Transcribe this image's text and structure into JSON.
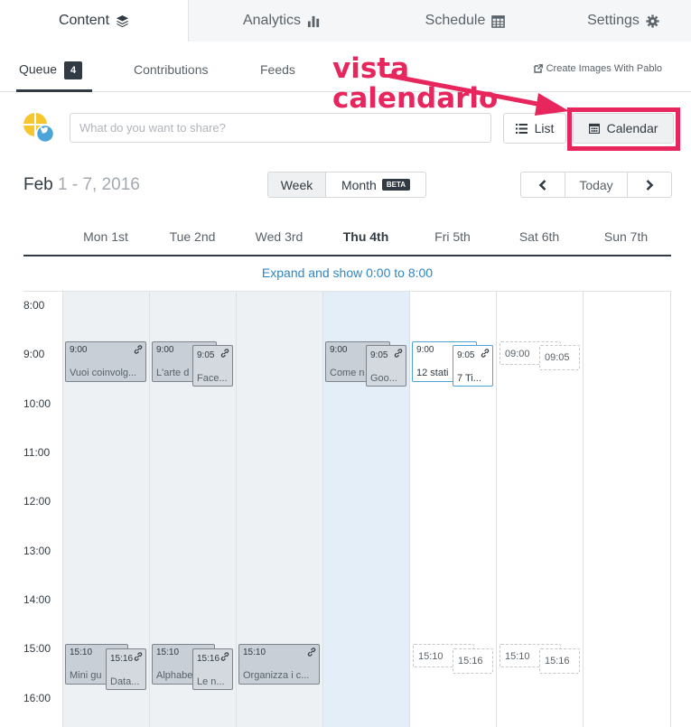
{
  "top_tabs": [
    {
      "label": "Content",
      "icon": "layers-icon",
      "active": true
    },
    {
      "label": "Analytics",
      "icon": "bar-chart-icon",
      "active": false
    },
    {
      "label": "Schedule",
      "icon": "calendar-grid-icon",
      "active": false
    },
    {
      "label": "Settings",
      "icon": "gear-icon",
      "active": false
    }
  ],
  "subnav": {
    "queue_label": "Queue",
    "queue_count": "4",
    "contributions_label": "Contributions",
    "feeds_label": "Feeds",
    "pablo_label": "Create Images With Pablo"
  },
  "annotation": {
    "line1": "vista",
    "line2": "calendario",
    "color": "#e8265e"
  },
  "composer": {
    "placeholder": "What do you want to share?"
  },
  "view_toggle": {
    "list_label": "List",
    "calendar_label": "Calendar"
  },
  "date_range": {
    "month": "Feb",
    "range": "1 - 7, 2016"
  },
  "period": {
    "week_label": "Week",
    "month_label": "Month",
    "beta_label": "BETA"
  },
  "nav": {
    "today_label": "Today"
  },
  "days": [
    "Mon 1st",
    "Tue 2nd",
    "Wed 3rd",
    "Thu 4th",
    "Fri 5th",
    "Sat 6th",
    "Sun 7th"
  ],
  "expand_label": "Expand and show 0:00 to 8:00",
  "hours": [
    "8:00",
    "9:00",
    "10:00",
    "11:00",
    "12:00",
    "13:00",
    "14:00",
    "15:00",
    "16:00"
  ],
  "events": {
    "mon_a": {
      "time": "9:00",
      "text": "Vuoi coinvolg..."
    },
    "tue_a": {
      "time": "9:00",
      "text": "L'arte d"
    },
    "tue_b": {
      "time": "9:05",
      "text": "Face..."
    },
    "thu_a": {
      "time": "9:00",
      "text": "Come n"
    },
    "thu_b": {
      "time": "9:05",
      "text": "Goo..."
    },
    "fri_a": {
      "time": "9:00",
      "text": "12 stati"
    },
    "fri_b": {
      "time": "9:05",
      "text": "7 Ti..."
    },
    "sat_a": {
      "time": "09:00"
    },
    "sat_b": {
      "time": "09:05"
    },
    "mon_c": {
      "time": "15:10",
      "text": "Mini gu"
    },
    "mon_d": {
      "time": "15:16",
      "text": "Data..."
    },
    "tue_c": {
      "time": "15:10",
      "text": "Alphabe"
    },
    "tue_d": {
      "time": "15:16",
      "text": "Le n..."
    },
    "wed_c": {
      "time": "15:10",
      "text": "Organizza i c..."
    },
    "fri_c": {
      "time": "15:10"
    },
    "fri_d": {
      "time": "15:16"
    },
    "sat_c": {
      "time": "15:10"
    },
    "sat_d": {
      "time": "15:16"
    }
  }
}
